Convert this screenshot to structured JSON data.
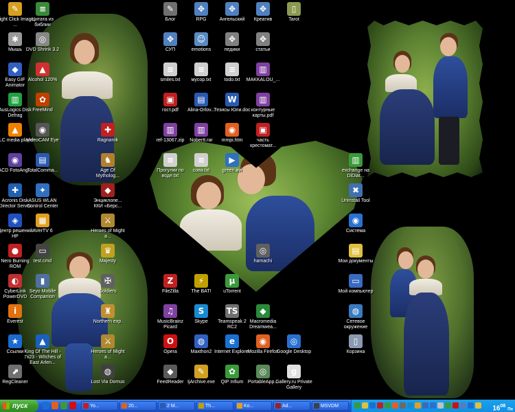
{
  "desktop": {
    "icons": [
      {
        "label": "Right Click Image ...",
        "glyph": "✎",
        "color": "#d8a020",
        "col": 0,
        "row": 0
      },
      {
        "label": "Мышь",
        "glyph": "✱",
        "color": "#999999",
        "col": 0,
        "row": 1
      },
      {
        "label": "Easy GIF Animator",
        "glyph": "◆",
        "color": "#3060c0",
        "col": 0,
        "row": 2
      },
      {
        "label": "AusLogics Disk Defrag",
        "glyph": "▥",
        "color": "#20a040",
        "col": 0,
        "row": 3
      },
      {
        "label": "VLC media player",
        "glyph": "▲",
        "color": "#f08000",
        "col": 0,
        "row": 4
      },
      {
        "label": "ACD FotoAng...",
        "glyph": "◉",
        "color": "#6040a0",
        "col": 0,
        "row": 5
      },
      {
        "label": "Acronis Disk Director Server",
        "glyph": "✚",
        "color": "#2060b0",
        "col": 0,
        "row": 6
      },
      {
        "label": "Центр решений HP",
        "glyph": "◈",
        "color": "#2050c0",
        "col": 0,
        "row": 7
      },
      {
        "label": "Nero Burning ROM",
        "glyph": "●",
        "color": "#c02020",
        "col": 0,
        "row": 8
      },
      {
        "label": "CyberLink PowerDVD",
        "glyph": "◐",
        "color": "#c03030",
        "col": 0,
        "row": 9
      },
      {
        "label": "Everest",
        "glyph": "i",
        "color": "#e07010",
        "col": 0,
        "row": 10
      },
      {
        "label": "Ссылки",
        "glyph": "★",
        "color": "#1a6ad0",
        "col": 0,
        "row": 11
      },
      {
        "label": "RegCleaner",
        "glyph": "⬈",
        "color": "#707070",
        "col": 0,
        "row": 12
      },
      {
        "label": "Цитата из библии",
        "glyph": "≡",
        "color": "#3a8a3a",
        "col": 1,
        "row": 0
      },
      {
        "label": "DVD Shrink 3.2",
        "glyph": "◎",
        "color": "#888888",
        "col": 1,
        "row": 1
      },
      {
        "label": "Alcohol 120%",
        "glyph": "▲",
        "color": "#d03030",
        "col": 1,
        "row": 2
      },
      {
        "label": "FreeMind",
        "glyph": "✿",
        "color": "#c04000",
        "col": 1,
        "row": 3
      },
      {
        "label": "VideoCAM Eye",
        "glyph": "◉",
        "color": "#555555",
        "col": 1,
        "row": 4
      },
      {
        "label": "TotalComma...",
        "glyph": "▤",
        "color": "#2a5ab0",
        "col": 1,
        "row": 5
      },
      {
        "label": "ASUS WLAN Control Center",
        "glyph": "✦",
        "color": "#3070c0",
        "col": 1,
        "row": 6
      },
      {
        "label": "AVerTV 6",
        "glyph": "▦",
        "color": "#e0a020",
        "col": 1,
        "row": 7
      },
      {
        "label": "test.cmd",
        "glyph": "▭",
        "color": "#444444",
        "col": 1,
        "row": 8
      },
      {
        "label": "Seyo Mobile Companion",
        "glyph": "▮",
        "color": "#5070a0",
        "col": 1,
        "row": 9
      },
      {
        "label": "King Of The Hill - 7x23 - Witches of East Arlen...",
        "glyph": "▲",
        "color": "#1a60c0",
        "col": 1,
        "row": 11
      },
      {
        "label": "Ragnarok",
        "glyph": "✚",
        "color": "#c02020",
        "col": 2,
        "row": 4
      },
      {
        "label": "Age Of Mytholog...",
        "glyph": "♞",
        "color": "#b08030",
        "col": 2,
        "row": 5
      },
      {
        "label": "Энциклопе... ККИ «Берс...",
        "glyph": "◆",
        "color": "#a02020",
        "col": 2,
        "row": 6
      },
      {
        "label": "Heroes of Might a...",
        "glyph": "⚔",
        "color": "#b08830",
        "col": 2,
        "row": 7
      },
      {
        "label": "Majesty",
        "glyph": "♛",
        "color": "#c0a020",
        "col": 2,
        "row": 8
      },
      {
        "label": "Soldiers",
        "glyph": "✠",
        "color": "#606060",
        "col": 2,
        "row": 9
      },
      {
        "label": "Heroes of Might a...",
        "glyph": "⚔",
        "color": "#b08830",
        "col": 2,
        "row": 11
      },
      {
        "label": "Lost Via Domus",
        "glyph": "◍",
        "color": "#404040",
        "col": 2,
        "row": 12
      },
      {
        "label": "Northern exp.",
        "glyph": "♜",
        "color": "#c09030",
        "col": 2,
        "row": 10
      },
      {
        "label": "Блог",
        "glyph": "✎",
        "color": "#707070",
        "col": 3,
        "row": 0
      },
      {
        "label": "СУП",
        "glyph": "✥",
        "color": "#5080c0",
        "col": 3,
        "row": 1
      },
      {
        "label": "smiles.txt",
        "glyph": "≡",
        "color": "#d0d0d0",
        "col": 3,
        "row": 2
      },
      {
        "label": "гост.pdf",
        "glyph": "▣",
        "color": "#c02020",
        "col": 3,
        "row": 3
      },
      {
        "label": "ref-13067.zip",
        "glyph": "▥",
        "color": "#8040a0",
        "col": 3,
        "row": 4
      },
      {
        "label": "Прогулки по воде.txt",
        "glyph": "≡",
        "color": "#d0d0d0",
        "col": 3,
        "row": 5
      },
      {
        "label": "FileZilla",
        "glyph": "Z",
        "color": "#c02020",
        "col": 3,
        "row": 9
      },
      {
        "label": "MusicBrainz Picard",
        "glyph": "♫",
        "color": "#8040a0",
        "col": 3,
        "row": 10
      },
      {
        "label": "Opera",
        "glyph": "O",
        "color": "#d01010",
        "col": 3,
        "row": 11
      },
      {
        "label": "FeedReader",
        "glyph": "◆",
        "color": "#5a5a5a",
        "col": 3,
        "row": 12
      },
      {
        "label": "RPG",
        "glyph": "✥",
        "color": "#5080c0",
        "col": 4,
        "row": 0
      },
      {
        "label": "emotions",
        "glyph": "☺",
        "color": "#5a8ac0",
        "col": 4,
        "row": 1
      },
      {
        "label": "мусор.txt",
        "glyph": "≡",
        "color": "#d0d0d0",
        "col": 4,
        "row": 2
      },
      {
        "label": "Alina-Orlov...",
        "glyph": "▤",
        "color": "#2a5ab0",
        "col": 4,
        "row": 3
      },
      {
        "label": "Nobertt.rar",
        "glyph": "▥",
        "color": "#8040a0",
        "col": 4,
        "row": 4
      },
      {
        "label": "сова.txt",
        "glyph": "≡",
        "color": "#d0d0d0",
        "col": 4,
        "row": 5
      },
      {
        "label": "The BAT!",
        "glyph": "⚡",
        "color": "#c0a000",
        "col": 4,
        "row": 9
      },
      {
        "label": "Skype",
        "glyph": "S",
        "color": "#1a8ad0",
        "col": 4,
        "row": 10
      },
      {
        "label": "Maxthon2",
        "glyph": "◍",
        "color": "#3060c0",
        "col": 4,
        "row": 11
      },
      {
        "label": "IjArchive.exe",
        "glyph": "✎",
        "color": "#d0a020",
        "col": 4,
        "row": 12
      },
      {
        "label": "Ангельский",
        "glyph": "✥",
        "color": "#5080c0",
        "col": 5,
        "row": 0
      },
      {
        "label": "педики",
        "glyph": "✥",
        "color": "#808080",
        "col": 5,
        "row": 1
      },
      {
        "label": "todo.txt",
        "glyph": "≡",
        "color": "#d0d0d0",
        "col": 5,
        "row": 2
      },
      {
        "label": "Тезисы Юли.doc",
        "glyph": "W",
        "color": "#2a5ab0",
        "col": 5,
        "row": 3
      },
      {
        "label": "mmpi.htm",
        "glyph": "◉",
        "color": "#e06020",
        "col": 5,
        "row": 4
      },
      {
        "label": "green.avi",
        "glyph": "▶",
        "color": "#3070c0",
        "col": 5,
        "row": 5
      },
      {
        "label": "uTorrent",
        "glyph": "µ",
        "color": "#3a9a3a",
        "col": 5,
        "row": 9
      },
      {
        "label": "Teamspeak 2 RC2",
        "glyph": "TS",
        "color": "#707070",
        "col": 5,
        "row": 10
      },
      {
        "label": "Internet Explorer",
        "glyph": "e",
        "color": "#1a70d0",
        "col": 5,
        "row": 11
      },
      {
        "label": "QIP Infium",
        "glyph": "✿",
        "color": "#3a9a3a",
        "col": 5,
        "row": 12
      },
      {
        "label": "Креатив",
        "glyph": "✥",
        "color": "#5080c0",
        "col": 6,
        "row": 0
      },
      {
        "label": "статьи",
        "glyph": "✥",
        "color": "#808080",
        "col": 6,
        "row": 1
      },
      {
        "label": "MAKKALOU_...",
        "glyph": "▥",
        "color": "#8040a0",
        "col": 6,
        "row": 2
      },
      {
        "label": "контурные карты.pdf",
        "glyph": "▥",
        "color": "#8040a0",
        "col": 6,
        "row": 3
      },
      {
        "label": "часть хрестомат...",
        "glyph": "▣",
        "color": "#c02020",
        "col": 6,
        "row": 4
      },
      {
        "label": "hamachi",
        "glyph": "◎",
        "color": "#606060",
        "col": 6,
        "row": 8
      },
      {
        "label": "Macromedia Dreamwea...",
        "glyph": "◆",
        "color": "#2a8a3a",
        "col": 6,
        "row": 10
      },
      {
        "label": "Mozilla Firefox",
        "glyph": "◉",
        "color": "#e06020",
        "col": 6,
        "row": 11
      },
      {
        "label": "PortableApp...",
        "glyph": "◎",
        "color": "#5a8a5a",
        "col": 6,
        "row": 12
      },
      {
        "label": "Tarot",
        "glyph": "▯",
        "color": "#8a9a50",
        "col": 7,
        "row": 0
      },
      {
        "label": "Google Desktop",
        "glyph": "◎",
        "color": "#2a70d0",
        "col": 7,
        "row": 11
      },
      {
        "label": "Gallery.ru Private Gallery",
        "glyph": "g",
        "color": "#e0e0e0",
        "col": 7,
        "row": 12
      },
      {
        "label": "exchange на DiDiat...",
        "glyph": "▥",
        "color": "#3a9a3a",
        "col": 8,
        "row": 5
      },
      {
        "label": "Uninstall Tool",
        "glyph": "✖",
        "color": "#4070b0",
        "col": 8,
        "row": 6
      },
      {
        "label": "Система",
        "glyph": "◉",
        "color": "#2a70d0",
        "col": 8,
        "row": 7
      },
      {
        "label": "Мои документы",
        "glyph": "▤",
        "color": "#e0c040",
        "col": 8,
        "row": 8
      },
      {
        "label": "Мой компьютер",
        "glyph": "▭",
        "color": "#3a6ac0",
        "col": 8,
        "row": 9
      },
      {
        "label": "Сетевое окружение",
        "glyph": "◍",
        "color": "#3a7ac0",
        "col": 8,
        "row": 10
      },
      {
        "label": "Корзина",
        "glyph": "▯",
        "color": "#8a9ab0",
        "col": 8,
        "row": 11
      }
    ]
  },
  "taskbar": {
    "start_label": "пуск",
    "quicklaunch": [
      {
        "name": "ie",
        "color": "#1a70d0"
      },
      {
        "name": "firefox",
        "color": "#e06020"
      },
      {
        "name": "qip",
        "color": "#3a9a3a"
      },
      {
        "name": "opera",
        "color": "#d01010"
      }
    ],
    "tasks": [
      {
        "label": "Yo...",
        "color": "#c02020"
      },
      {
        "label": "20...",
        "color": "#e06020"
      },
      {
        "label": "2 M...",
        "color": "#2a5ab0"
      },
      {
        "label": "Th...",
        "color": "#c0a000"
      },
      {
        "label": "Ko...",
        "color": "#e0a020"
      },
      {
        "label": "Ad...",
        "color": "#a02020"
      },
      {
        "label": "MSVDM",
        "color": "#404040"
      }
    ],
    "tray_colors": [
      "#3a9a3a",
      "#e0c040",
      "#1a70d0",
      "#c02020",
      "#3a9a3a",
      "#e06020",
      "#6a6a6a",
      "#1a8ad0",
      "#e0a020",
      "#3a6ac0",
      "#2a70d0",
      "#c0c0c0",
      "#3a9a3a",
      "#d01010",
      "#5080c0",
      "#1a70d0",
      "#e0c040"
    ],
    "clock": "16",
    "clock_min": "08",
    "clock_day": "Пн"
  }
}
